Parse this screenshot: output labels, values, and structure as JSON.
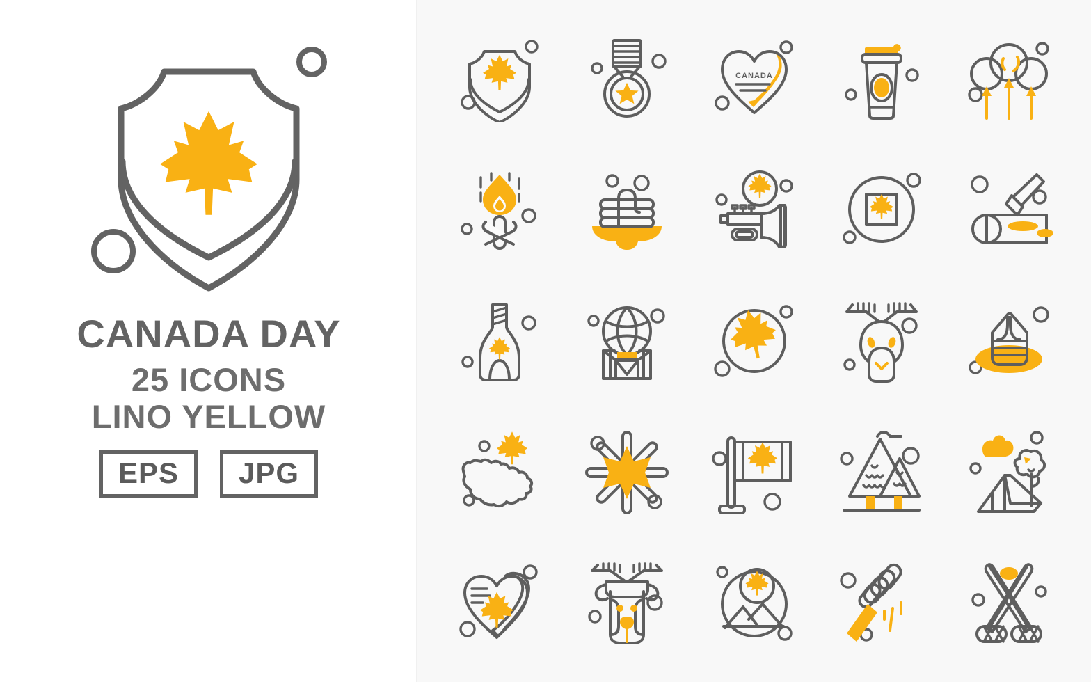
{
  "cover": {
    "title": "CANADA DAY",
    "count_line": "25 ICONS",
    "style_line": "LINO YELLOW",
    "formats": [
      "EPS",
      "JPG"
    ],
    "hero_icon": "maple-leaf-shield",
    "colors": {
      "accent_yellow": "#f9b114",
      "stroke_grey": "#5e5e5e",
      "title_grey": "#636363",
      "left_bg": "#ffffff",
      "right_bg": "#f8f8f8"
    }
  },
  "grid": {
    "columns": 5,
    "rows": 5,
    "total": 25,
    "icons": [
      {
        "name": "maple-leaf-shield-icon",
        "label": "Shield"
      },
      {
        "name": "star-medal-icon",
        "label": "Medal"
      },
      {
        "name": "canada-heart-badge-icon",
        "label": "Canada Heart",
        "text": "CANADA"
      },
      {
        "name": "coffee-cup-icon",
        "label": "Coffee Cup"
      },
      {
        "name": "cloud-balloons-icon",
        "label": "Clouds"
      },
      {
        "name": "bonfire-icon",
        "label": "Bonfire"
      },
      {
        "name": "pancakes-syrup-icon",
        "label": "Pancakes"
      },
      {
        "name": "trumpet-maple-icon",
        "label": "Trumpet"
      },
      {
        "name": "maple-leaf-frame-circle-icon",
        "label": "Framed Leaf"
      },
      {
        "name": "log-axe-icon",
        "label": "Log and Axe"
      },
      {
        "name": "maple-syrup-bottle-icon",
        "label": "Syrup Bottle"
      },
      {
        "name": "hot-air-balloon-basket-icon",
        "label": "Balloon"
      },
      {
        "name": "maple-leaf-circle-icon",
        "label": "Maple Leaf"
      },
      {
        "name": "moose-head-icon",
        "label": "Moose"
      },
      {
        "name": "beaver-hat-icon",
        "label": "Fur Hat"
      },
      {
        "name": "canada-map-icon",
        "label": "Canada Map"
      },
      {
        "name": "snowflake-star-icon",
        "label": "Snowflake"
      },
      {
        "name": "canada-flag-pole-icon",
        "label": "Flag"
      },
      {
        "name": "pine-forest-icon",
        "label": "Forest"
      },
      {
        "name": "camping-tent-icon",
        "label": "Tent"
      },
      {
        "name": "heart-maple-leaf-icon",
        "label": "Heart Leaf"
      },
      {
        "name": "deer-face-icon",
        "label": "Deer"
      },
      {
        "name": "mountain-landscape-icon",
        "label": "Mountains"
      },
      {
        "name": "fist-torch-icon",
        "label": "Torch"
      },
      {
        "name": "hockey-sticks-puck-icon",
        "label": "Hockey"
      }
    ]
  }
}
